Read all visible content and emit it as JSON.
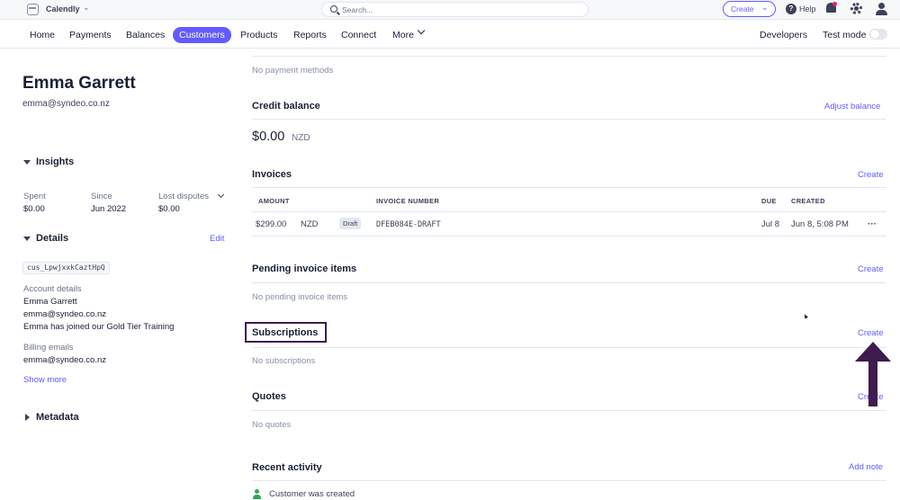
{
  "topbar": {
    "account_name": "Calendly",
    "search_placeholder": "Search...",
    "create_label": "Create",
    "help_label": "Help"
  },
  "nav": {
    "items": [
      "Home",
      "Payments",
      "Balances",
      "Customers",
      "Products",
      "Reports",
      "Connect",
      "More"
    ],
    "active": "Customers",
    "developers": "Developers",
    "test_mode": "Test mode"
  },
  "customer": {
    "name": "Emma Garrett",
    "email": "emma@syndeo.co.nz"
  },
  "insights": {
    "title": "Insights",
    "stats": [
      {
        "label": "Spent",
        "value": "$0.00"
      },
      {
        "label": "Since",
        "value": "Jun 2022"
      },
      {
        "label": "Lost disputes",
        "value": "$0.00"
      }
    ]
  },
  "details": {
    "title": "Details",
    "edit": "Edit",
    "customer_id": "cus_LpwjxxkCaztHpQ",
    "account_details_label": "Account details",
    "account_lines": [
      "Emma Garrett",
      "emma@syndeo.co.nz",
      "Emma has joined our Gold Tier Training"
    ],
    "billing_emails_label": "Billing emails",
    "billing_email": "emma@syndeo.co.nz",
    "show_more": "Show more"
  },
  "metadata": {
    "title": "Metadata"
  },
  "payment_methods": {
    "empty": "No payment methods"
  },
  "credit_balance": {
    "title": "Credit balance",
    "action": "Adjust balance",
    "amount": "$0.00",
    "currency": "NZD"
  },
  "invoices": {
    "title": "Invoices",
    "action": "Create",
    "columns": {
      "amount": "AMOUNT",
      "number": "INVOICE NUMBER",
      "due": "DUE",
      "created": "CREATED"
    },
    "rows": [
      {
        "amount": "$299.00",
        "currency": "NZD",
        "status": "Draft",
        "number": "DFEB084E-DRAFT",
        "due": "Jul 8",
        "created": "Jun 8, 5:08 PM"
      }
    ]
  },
  "pending_items": {
    "title": "Pending invoice items",
    "action": "Create",
    "empty": "No pending invoice items"
  },
  "subscriptions": {
    "title": "Subscriptions",
    "action": "Create",
    "empty": "No subscriptions"
  },
  "quotes": {
    "title": "Quotes",
    "action": "Create",
    "empty": "No quotes"
  },
  "recent_activity": {
    "title": "Recent activity",
    "action": "Add note",
    "items": [
      "Customer was created"
    ]
  },
  "colors": {
    "accent": "#635bff",
    "annotation": "#3e1c4d"
  }
}
